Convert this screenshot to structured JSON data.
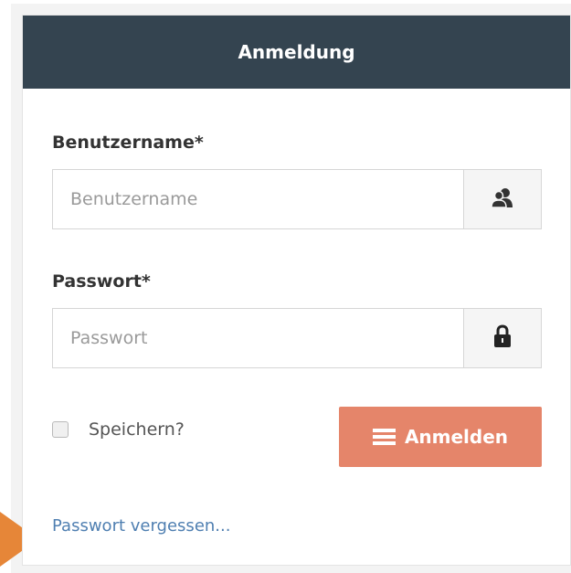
{
  "header": {
    "title": "Anmeldung"
  },
  "username": {
    "label": "Benutzername*",
    "placeholder": "Benutzername",
    "value": "",
    "icon": "users-icon"
  },
  "password": {
    "label": "Passwort*",
    "placeholder": "Passwort",
    "value": "",
    "icon": "lock-icon"
  },
  "remember": {
    "label": "Speichern?",
    "checked": false
  },
  "login_button": {
    "label": "Anmelden",
    "icon": "menu-icon"
  },
  "forgot_link": {
    "label": "Passwort vergessen..."
  },
  "colors": {
    "header_bg": "#344450",
    "button_bg": "#e5856a",
    "link": "#4f7fb1",
    "arrow": "#e68638"
  }
}
